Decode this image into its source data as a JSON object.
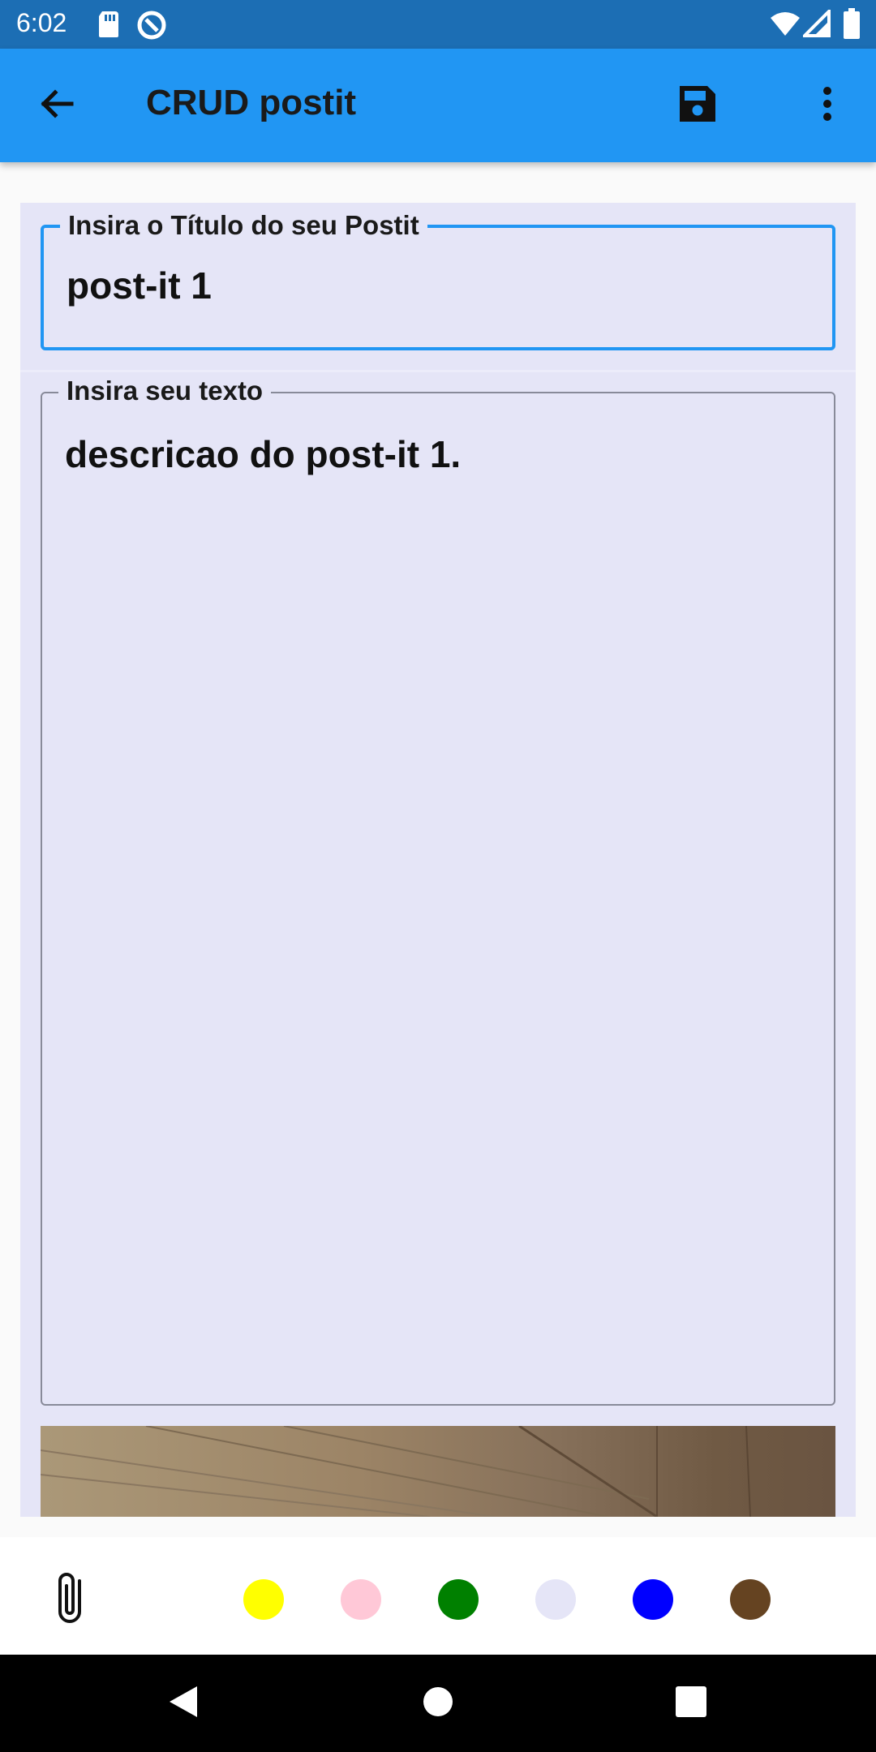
{
  "status_bar": {
    "time": "6:02",
    "icons": [
      "sd-card-icon",
      "data-saver-icon",
      "wifi-icon",
      "signal-icon",
      "battery-icon"
    ]
  },
  "app_bar": {
    "title": "CRUD postit",
    "back_icon": "arrow-back-icon",
    "save_icon": "save-icon",
    "more_icon": "more-vert-icon",
    "color": "#2196f3"
  },
  "form": {
    "title_field": {
      "label": "Insira o Título do seu Postit",
      "value": "post-it 1"
    },
    "text_field": {
      "label": "Insira seu texto",
      "value": "descricao do post-it 1."
    },
    "note_background": "#e5e5f7"
  },
  "bottom_bar": {
    "attach_icon": "paperclip-icon",
    "colors": [
      "#ffff00",
      "#ffc8d7",
      "#008000",
      "#e5e5f7",
      "#0000ff",
      "#654321"
    ]
  },
  "nav_bar": {
    "icons": [
      "back-triangle-icon",
      "home-circle-icon",
      "recents-square-icon"
    ]
  }
}
